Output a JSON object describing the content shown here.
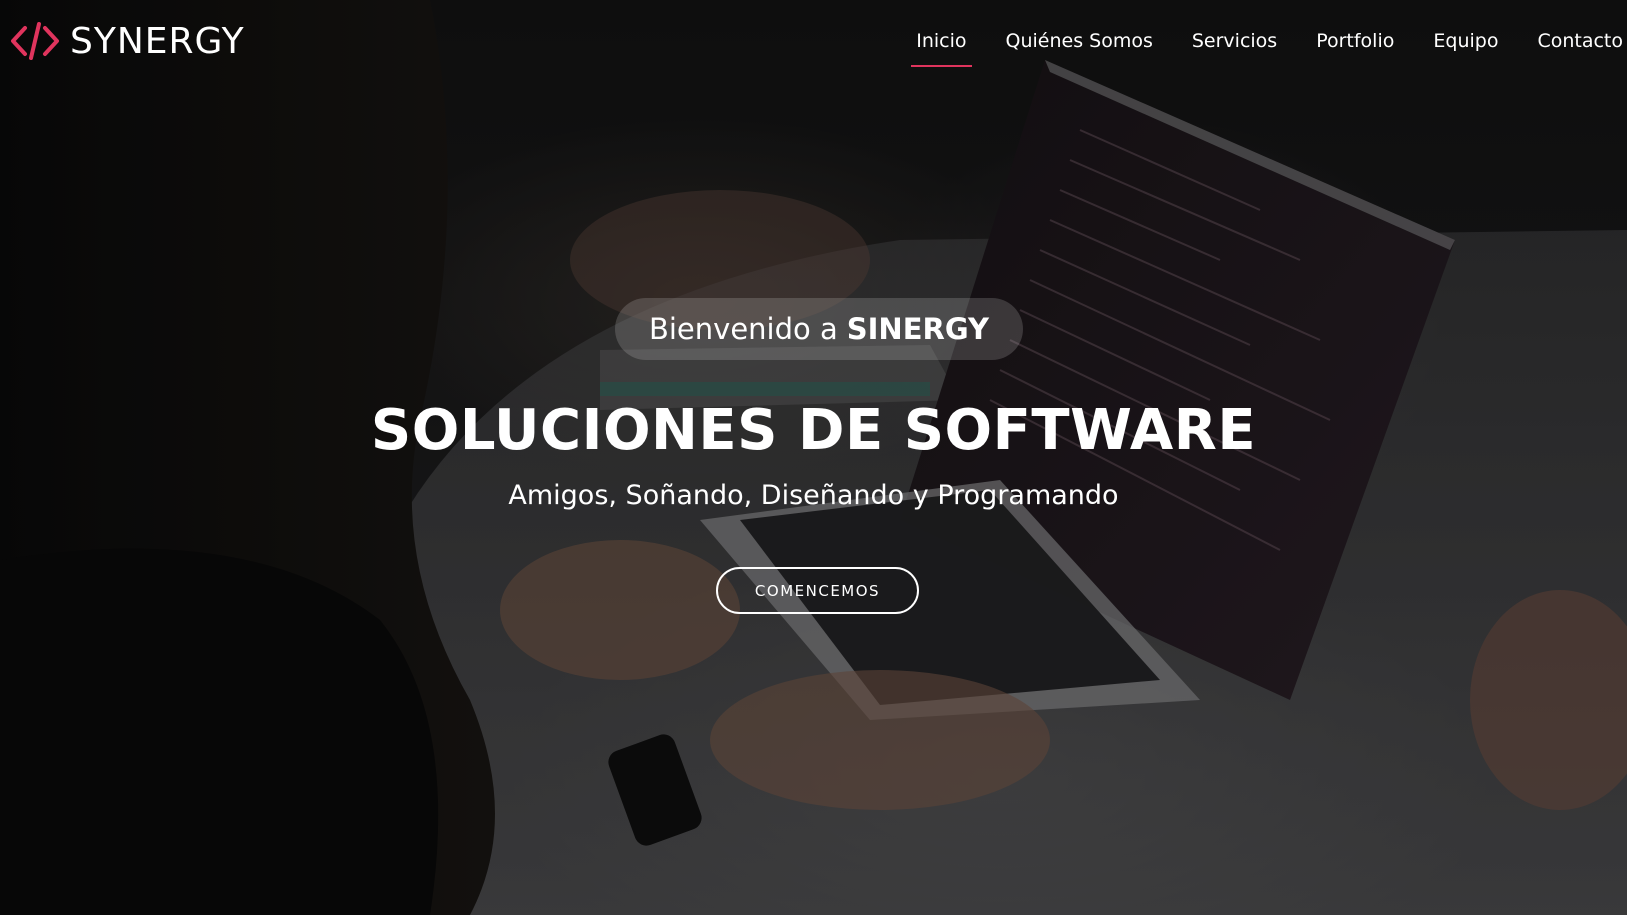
{
  "brand": {
    "name": "SYNERGY",
    "accent_color": "#e0345d",
    "logo_icon": "code-brackets-icon"
  },
  "nav": {
    "items": [
      {
        "label": "Inicio",
        "active": true
      },
      {
        "label": "Quiénes Somos",
        "active": false
      },
      {
        "label": "Servicios",
        "active": false
      },
      {
        "label": "Portfolio",
        "active": false
      },
      {
        "label": "Equipo",
        "active": false
      },
      {
        "label": "Contacto",
        "active": false
      }
    ]
  },
  "hero": {
    "welcome_prefix": "Bienvenido a",
    "welcome_brand": "SINERGY",
    "headline": "SOLUCIONES DE SOFTWARE",
    "subtitle": "Amigos, Soñando, Diseñando y Programando",
    "cta_label": "COMENCEMOS"
  }
}
